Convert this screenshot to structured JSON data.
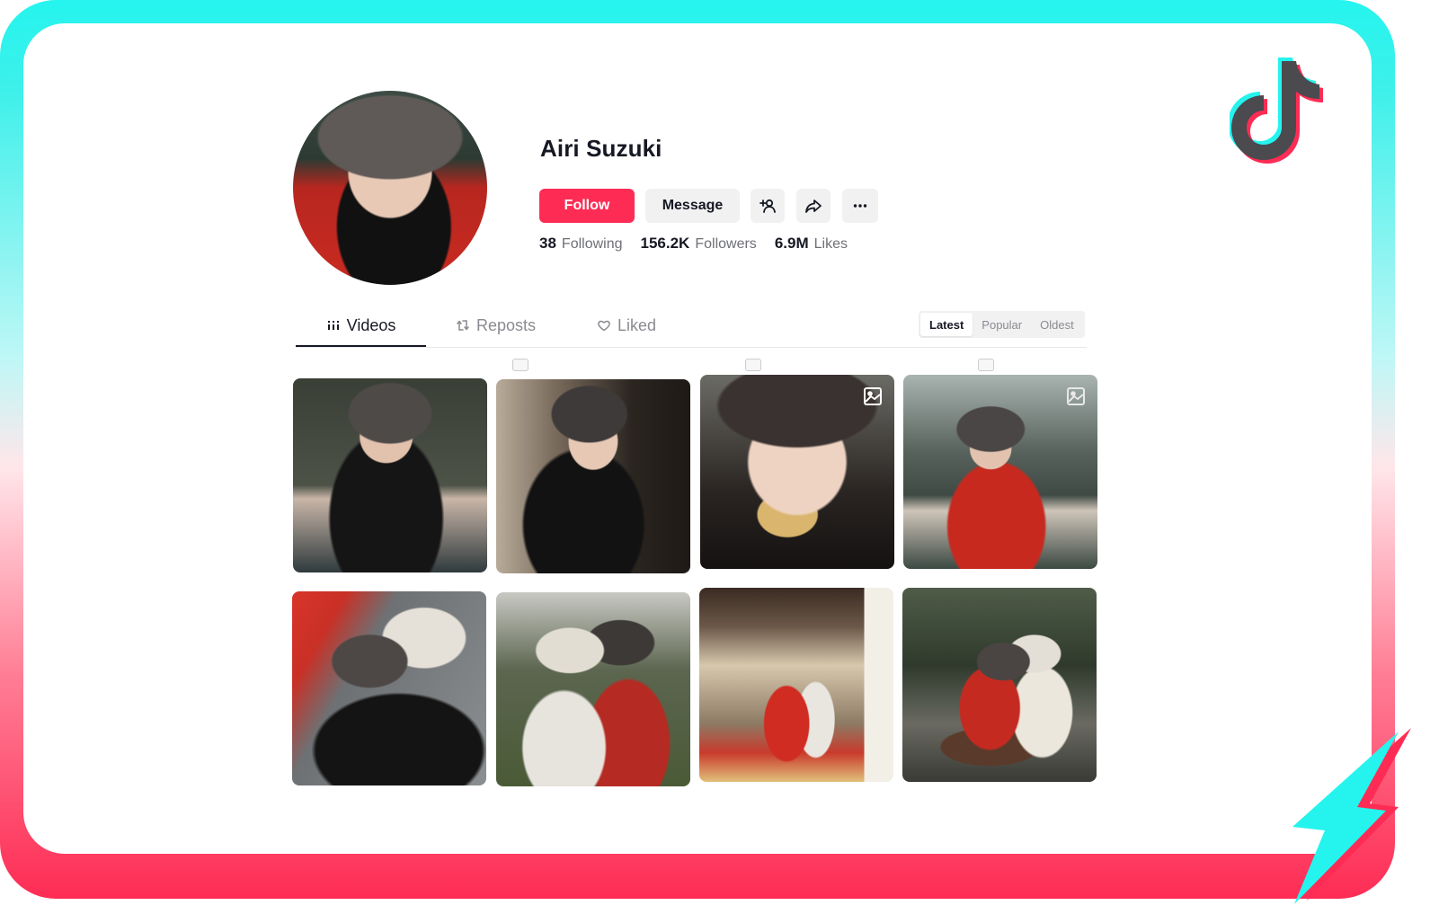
{
  "profile": {
    "name": "Airi Suzuki",
    "follow_label": "Follow",
    "message_label": "Message",
    "stats": [
      {
        "num": "38",
        "label": "Following"
      },
      {
        "num": "156.2K",
        "label": "Followers"
      },
      {
        "num": "6.9M",
        "label": "Likes"
      }
    ]
  },
  "tabs": [
    {
      "label": "Videos",
      "active": true
    },
    {
      "label": "Reposts",
      "active": false
    },
    {
      "label": "Liked",
      "active": false
    }
  ],
  "sort": [
    {
      "label": "Latest",
      "active": true
    },
    {
      "label": "Popular",
      "active": false
    },
    {
      "label": "Oldest",
      "active": false
    }
  ],
  "colors": {
    "accent": "#fe2c55",
    "cyan": "#25f4ee",
    "text": "#161823",
    "muted": "#8a8b91"
  },
  "icons": {
    "add_friend": "add-friend-icon",
    "share": "share-icon",
    "more": "more-icon",
    "videos": "grid-icon",
    "reposts": "repost-icon",
    "liked": "heart-icon",
    "photo": "photo-icon",
    "logo": "tiktok-logo-icon",
    "bolt": "lightning-icon"
  }
}
